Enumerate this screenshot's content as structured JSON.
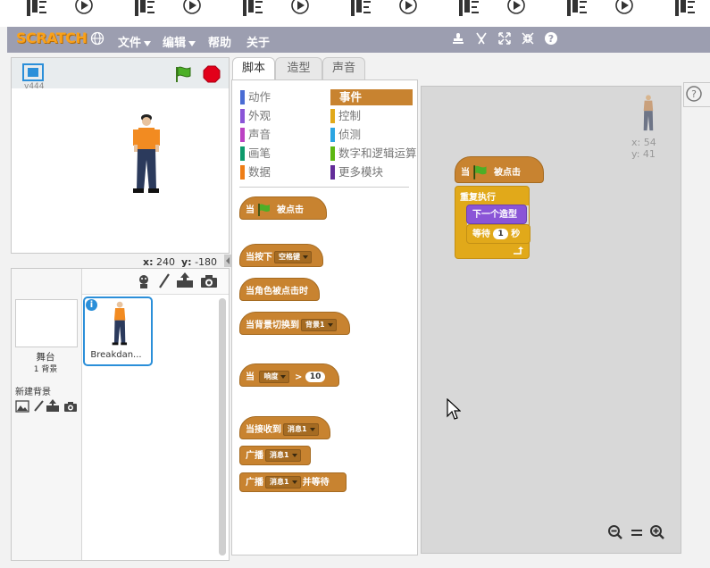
{
  "menubar": {
    "logo": "SCRATCH",
    "menus": [
      "文件",
      "编辑",
      "帮助",
      "关于"
    ]
  },
  "stage": {
    "version": "v444",
    "coord_x_label": "x:",
    "coord_x": "240",
    "coord_y_label": "y:",
    "coord_y": "-180"
  },
  "sprites": {
    "stage_label": "舞台",
    "stage_count": "1 背景",
    "new_backdrop": "新建背景",
    "sprite_name": "Breakdan..."
  },
  "tabs": [
    "脚本",
    "造型",
    "声音"
  ],
  "categories": {
    "left": [
      {
        "label": "动作",
        "color": "#4a6cd4"
      },
      {
        "label": "外观",
        "color": "#8a55d7"
      },
      {
        "label": "声音",
        "color": "#bb42c3"
      },
      {
        "label": "画笔",
        "color": "#0e9a6c"
      },
      {
        "label": "数据",
        "color": "#ee7d16"
      }
    ],
    "right": [
      {
        "label": "事件",
        "color": "#c88330",
        "active": true
      },
      {
        "label": "控制",
        "color": "#e1a91a"
      },
      {
        "label": "侦测",
        "color": "#2ca5e2"
      },
      {
        "label": "数字和逻辑运算",
        "color": "#5cb712"
      },
      {
        "label": "更多模块",
        "color": "#632d99"
      }
    ]
  },
  "palette_blocks": {
    "when_flag_a": "当",
    "when_flag_b": "被点击",
    "when_key": "当按下",
    "key_dd": "空格键",
    "when_sprite_clicked": "当角色被点击时",
    "when_backdrop": "当背景切换到",
    "backdrop_dd": "背景1",
    "when_a": "当",
    "loudness_dd": "响度",
    "gt": ">",
    "gt_value": "10",
    "when_receive": "当接收到",
    "msg1": "消息1",
    "broadcast": "广播",
    "msg2": "消息1",
    "broadcast_wait_a": "广播",
    "msg3": "消息1",
    "broadcast_wait_b": "并等待"
  },
  "script": {
    "hat_a": "当",
    "hat_b": "被点击",
    "forever": "重复执行",
    "next_costume": "下一个造型",
    "wait_a": "等待",
    "wait_value": "1",
    "wait_b": "秒",
    "sprite_x_label": "x:",
    "sprite_x": "54",
    "sprite_y_label": "y:",
    "sprite_y": "41"
  },
  "colors": {
    "menubar": "#9c9eb0",
    "events": "#c88330",
    "control": "#e1a91a",
    "looks": "#8a55d7",
    "selection": "#2b8fd9"
  }
}
